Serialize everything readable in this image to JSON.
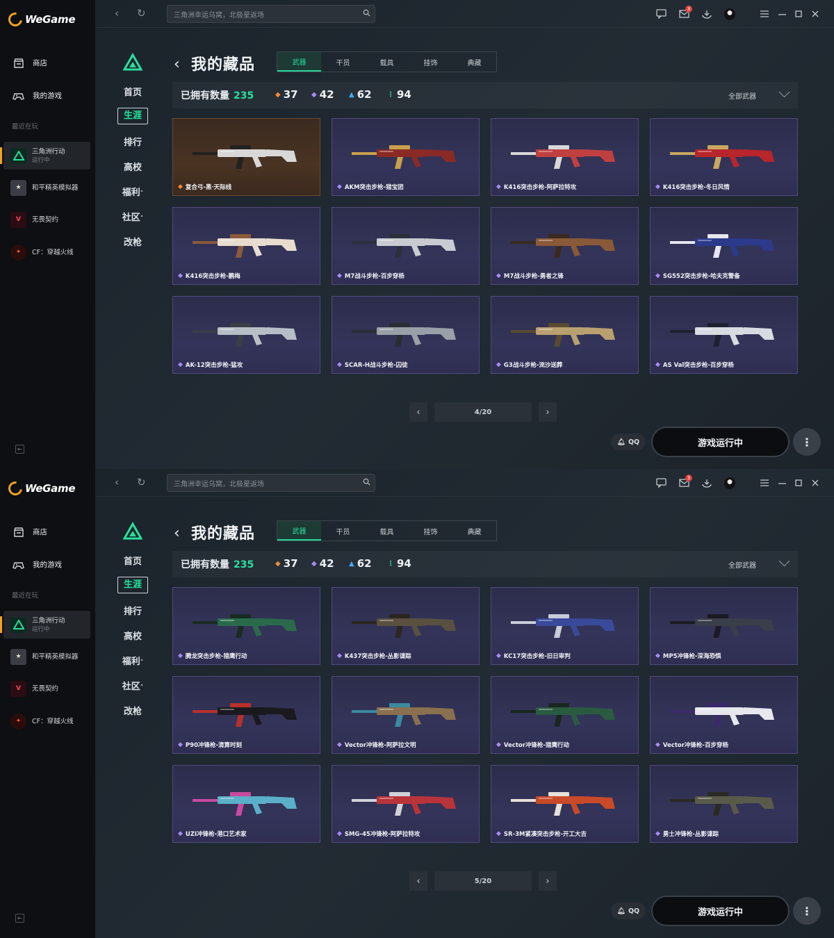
{
  "app": {
    "logo_text": "WeGame"
  },
  "sidebar": {
    "items": [
      {
        "label": "商店",
        "icon": "store-icon"
      },
      {
        "label": "我的游戏",
        "icon": "gamepad-icon"
      }
    ],
    "recent_label": "最近在玩",
    "games": [
      {
        "name": "三角洲行动",
        "status": "运行中"
      },
      {
        "name": "和平精英模拟器",
        "status": ""
      },
      {
        "name": "无畏契约",
        "status": ""
      },
      {
        "name": "CF：穿越火线",
        "status": ""
      }
    ]
  },
  "topbar": {
    "search_placeholder": "三角洲幸运乌窝，北极星返场",
    "mail_badge": "3"
  },
  "game_nav": [
    "首页",
    "生涯",
    "排行",
    "高校",
    "福利",
    "社区",
    "改枪"
  ],
  "collection": {
    "title": "我的藏品",
    "tabs": [
      "武器",
      "干员",
      "载具",
      "挂饰",
      "典藏"
    ],
    "owned_label": "已拥有数量",
    "owned_count": "235",
    "rarity_counts": [
      "37",
      "42",
      "62",
      "94"
    ],
    "filter_label": "全部武器",
    "run_button": "游戏运行中",
    "qq_label": "QQ"
  },
  "screens": [
    {
      "page": "4/20",
      "cards": [
        {
          "name": "复合弓-黑·天际线",
          "tier": "gold",
          "color": "#d8d8d8",
          "accent": "#222222"
        },
        {
          "name": "AKM突击步枪-猎宝团",
          "tier": "purple",
          "color": "#8a2a25",
          "accent": "#c9a04a"
        },
        {
          "name": "K416突击步枪-阿萨拉特攻",
          "tier": "purple",
          "color": "#c04040",
          "accent": "#d8d8d8"
        },
        {
          "name": "K416突击步枪-冬日风情",
          "tier": "purple",
          "color": "#b8252b",
          "accent": "#c8a860"
        },
        {
          "name": "K416突击步枪-鹏梅",
          "tier": "purple",
          "color": "#e8dccf",
          "accent": "#8b5a3a"
        },
        {
          "name": "M7战斗步枪-百步穿杨",
          "tier": "purple",
          "color": "#c8ccd2",
          "accent": "#2b2f3a"
        },
        {
          "name": "M7战斗步枪-勇者之锋",
          "tier": "purple",
          "color": "#8a5a38",
          "accent": "#3a2a1e"
        },
        {
          "name": "SG552突击步枪-哈夫克警备",
          "tier": "purple",
          "color": "#2b3a8a",
          "accent": "#e6e6ee"
        },
        {
          "name": "AK-12突击步枪-猛攻",
          "tier": "purple",
          "color": "#b8bec6",
          "accent": "#3a3e45"
        },
        {
          "name": "SCAR-H战斗步枪-囚徒",
          "tier": "purple",
          "color": "#9aa0a8",
          "accent": "#2a2d33"
        },
        {
          "name": "G3战斗步枪-流沙送葬",
          "tier": "purple",
          "color": "#b8a070",
          "accent": "#5a4a30"
        },
        {
          "name": "AS Val突击步枪-百步穿杨",
          "tier": "purple",
          "color": "#d8dce2",
          "accent": "#1e2230"
        }
      ]
    },
    {
      "page": "5/20",
      "cards": [
        {
          "name": "腾龙突击步枪-猎鹰行动",
          "tier": "purple",
          "color": "#2a6a4a",
          "accent": "#1a2a22"
        },
        {
          "name": "K437突击步枪-丛影谍踪",
          "tier": "purple",
          "color": "#5a5040",
          "accent": "#2a2620"
        },
        {
          "name": "KC17突击步枪-旧日审判",
          "tier": "purple",
          "color": "#3a4a9a",
          "accent": "#c8ccd8"
        },
        {
          "name": "MP5冲锋枪-深海恐惧",
          "tier": "purple",
          "color": "#3a3e48",
          "accent": "#1a1c22"
        },
        {
          "name": "P90冲锋枪-清算时刻",
          "tier": "purple",
          "color": "#1a1a1e",
          "accent": "#b8302a"
        },
        {
          "name": "Vector冲锋枪-阿萨拉文明",
          "tier": "purple",
          "color": "#8a7050",
          "accent": "#3a8aa0"
        },
        {
          "name": "Vector冲锋枪-猎鹰行动",
          "tier": "purple",
          "color": "#2a5a40",
          "accent": "#1a2620"
        },
        {
          "name": "Vector冲锋枪-百步穿杨",
          "tier": "purple",
          "color": "#e6e8ee",
          "accent": "#3a2a6a"
        },
        {
          "name": "UZI冲锋枪-港口艺术家",
          "tier": "purple",
          "color": "#5ab0c8",
          "accent": "#c84aa0"
        },
        {
          "name": "SMG-45冲锋枪-阿萨拉特攻",
          "tier": "purple",
          "color": "#b8343a",
          "accent": "#d0d2d8"
        },
        {
          "name": "SR-3M紧凑突击步枪-开工大吉",
          "tier": "purple",
          "color": "#c84a28",
          "accent": "#e6e0d8"
        },
        {
          "name": "勇士冲锋枪-丛影谍踪",
          "tier": "purple",
          "color": "#5a5a4a",
          "accent": "#2a2a24"
        }
      ]
    }
  ]
}
